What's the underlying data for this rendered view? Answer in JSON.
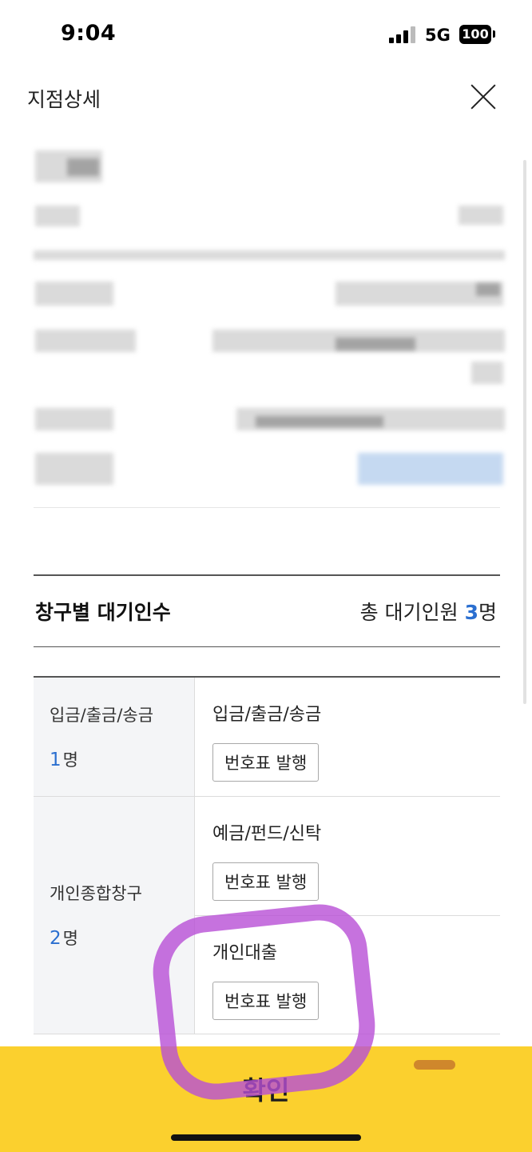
{
  "status_bar": {
    "time": "9:04",
    "network": "5G",
    "battery": "100"
  },
  "header": {
    "title": "지점상세",
    "close_icon": "close-icon"
  },
  "waiting": {
    "title": "창구별 대기인수",
    "total_prefix": "총 대기인원",
    "total_count": "3",
    "total_unit": "명"
  },
  "windows": [
    {
      "name": "입금/출금/송금",
      "count": "1",
      "unit": "명",
      "services": [
        {
          "name": "입금/출금/송금",
          "button": "번호표 발행"
        }
      ]
    },
    {
      "name": "개인종합창구",
      "count": "2",
      "unit": "명",
      "services": [
        {
          "name": "예금/펀드/신탁",
          "button": "번호표 발행"
        },
        {
          "name": "개인대출",
          "button": "번호표 발행"
        }
      ]
    }
  ],
  "footer": {
    "confirm_label": "확인"
  },
  "colors": {
    "accent_blue": "#2b6fd0",
    "confirm_yellow": "#fbd02e",
    "highlight_purple": "#b84fd6"
  }
}
